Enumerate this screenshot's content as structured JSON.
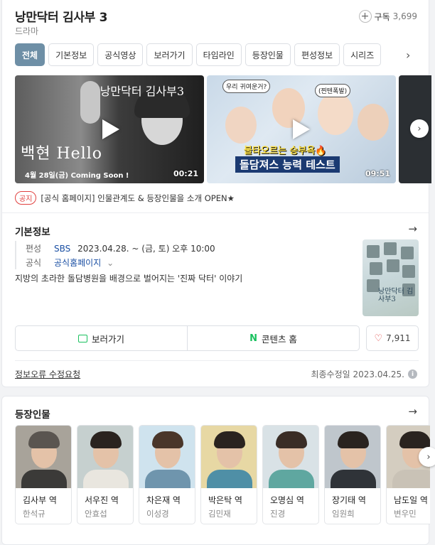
{
  "header": {
    "title": "낭만닥터 김사부 3",
    "subtitle": "드라마",
    "subscribe_label": "구독",
    "subscribe_count": "3,699"
  },
  "tabs": [
    {
      "label": "전체",
      "active": true
    },
    {
      "label": "기본정보"
    },
    {
      "label": "공식영상"
    },
    {
      "label": "보러가기"
    },
    {
      "label": "타임라인"
    },
    {
      "label": "등장인물"
    },
    {
      "label": "편성정보"
    },
    {
      "label": "시리즈"
    }
  ],
  "videos": [
    {
      "duration": "00:21",
      "caption": "백현 Hello",
      "date_text": "4월 28일(금) Coming Soon !",
      "logo_text": "낭만닥터 김사부3"
    },
    {
      "duration": "09:51",
      "headline": "불타오르는 승부욕🔥",
      "banner": "돌담져스 능력 테스트",
      "bubble_left": "우리 귀여운거?",
      "bubble_right": "(찐텐폭발)"
    }
  ],
  "notice": {
    "badge": "공지",
    "text": "[공식 홈페이지] 인물관계도 & 등장인물을 소개 OPEN★"
  },
  "basic_info": {
    "section_title": "기본정보",
    "schedule_key": "편성",
    "broadcaster": "SBS",
    "schedule_value": "2023.04.28. ~  (금, 토) 오후 10:00",
    "official_key": "공식",
    "official_value": "공식홈페이지",
    "description": "지방의 초라한 돌담병원을 배경으로 벌어지는 '진짜 닥터' 이야기",
    "poster_title": "낭만닥터 김사부3"
  },
  "actions": {
    "watch_label": "보러가기",
    "content_home_label": "콘텐츠 홈",
    "like_count": "7,911"
  },
  "footer": {
    "fix_request": "정보오류 수정요청",
    "updated_text": "최종수정일 2023.04.25."
  },
  "cast_section": {
    "title": "등장인물",
    "members": [
      {
        "role": "김사부 역",
        "actor": "한석규",
        "outfit": "#3b3a38"
      },
      {
        "role": "서우진 역",
        "actor": "안효섭",
        "outfit": "#e9e6df"
      },
      {
        "role": "차은재 역",
        "actor": "이성경",
        "outfit": "#6f95ad"
      },
      {
        "role": "박은탁 역",
        "actor": "김민재",
        "outfit": "#4f8fa6"
      },
      {
        "role": "오명심 역",
        "actor": "진경",
        "outfit": "#5fa7a0"
      },
      {
        "role": "장기태 역",
        "actor": "임원희",
        "outfit": "#2f3338"
      },
      {
        "role": "남도일 역",
        "actor": "변우민",
        "outfit": "#c9c2b6"
      }
    ]
  },
  "colors": {
    "accent_tab": "#6e8fa6",
    "naver_green": "#19c15e",
    "notice_red": "#e0413f",
    "link_blue": "#1a4fa3"
  }
}
